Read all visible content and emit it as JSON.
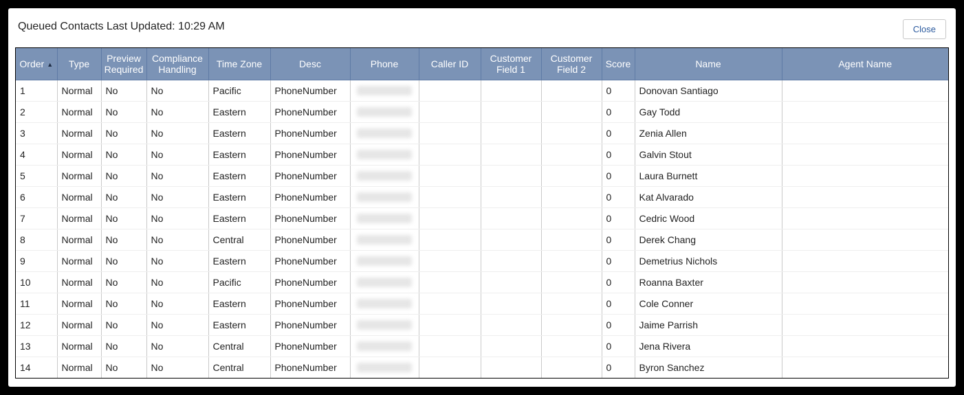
{
  "header": {
    "status_text": "Queued Contacts Last Updated: 10:29 AM",
    "close_label": "Close"
  },
  "table": {
    "sort_column": "Order",
    "sort_dir": "asc",
    "columns": [
      {
        "key": "order",
        "label": "Order"
      },
      {
        "key": "type",
        "label": "Type"
      },
      {
        "key": "preview",
        "label": "Preview Required"
      },
      {
        "key": "compliance",
        "label": "Compliance Handling"
      },
      {
        "key": "tz",
        "label": "Time Zone"
      },
      {
        "key": "desc",
        "label": "Desc"
      },
      {
        "key": "phone",
        "label": "Phone"
      },
      {
        "key": "callerid",
        "label": "Caller ID"
      },
      {
        "key": "cf1",
        "label": "Customer Field 1"
      },
      {
        "key": "cf2",
        "label": "Customer Field 2"
      },
      {
        "key": "score",
        "label": "Score"
      },
      {
        "key": "name",
        "label": "Name"
      },
      {
        "key": "agent",
        "label": "Agent Name"
      }
    ],
    "rows": [
      {
        "order": "1",
        "type": "Normal",
        "preview": "No",
        "compliance": "No",
        "tz": "Pacific",
        "desc": "PhoneNumber",
        "phone": "",
        "callerid": "",
        "cf1": "",
        "cf2": "",
        "score": "0",
        "name": "Donovan Santiago",
        "agent": ""
      },
      {
        "order": "2",
        "type": "Normal",
        "preview": "No",
        "compliance": "No",
        "tz": "Eastern",
        "desc": "PhoneNumber",
        "phone": "",
        "callerid": "",
        "cf1": "",
        "cf2": "",
        "score": "0",
        "name": "Gay Todd",
        "agent": ""
      },
      {
        "order": "3",
        "type": "Normal",
        "preview": "No",
        "compliance": "No",
        "tz": "Eastern",
        "desc": "PhoneNumber",
        "phone": "",
        "callerid": "",
        "cf1": "",
        "cf2": "",
        "score": "0",
        "name": "Zenia Allen",
        "agent": ""
      },
      {
        "order": "4",
        "type": "Normal",
        "preview": "No",
        "compliance": "No",
        "tz": "Eastern",
        "desc": "PhoneNumber",
        "phone": "",
        "callerid": "",
        "cf1": "",
        "cf2": "",
        "score": "0",
        "name": "Galvin Stout",
        "agent": ""
      },
      {
        "order": "5",
        "type": "Normal",
        "preview": "No",
        "compliance": "No",
        "tz": "Eastern",
        "desc": "PhoneNumber",
        "phone": "",
        "callerid": "",
        "cf1": "",
        "cf2": "",
        "score": "0",
        "name": "Laura Burnett",
        "agent": ""
      },
      {
        "order": "6",
        "type": "Normal",
        "preview": "No",
        "compliance": "No",
        "tz": "Eastern",
        "desc": "PhoneNumber",
        "phone": "",
        "callerid": "",
        "cf1": "",
        "cf2": "",
        "score": "0",
        "name": "Kat Alvarado",
        "agent": ""
      },
      {
        "order": "7",
        "type": "Normal",
        "preview": "No",
        "compliance": "No",
        "tz": "Eastern",
        "desc": "PhoneNumber",
        "phone": "",
        "callerid": "",
        "cf1": "",
        "cf2": "",
        "score": "0",
        "name": "Cedric Wood",
        "agent": ""
      },
      {
        "order": "8",
        "type": "Normal",
        "preview": "No",
        "compliance": "No",
        "tz": "Central",
        "desc": "PhoneNumber",
        "phone": "",
        "callerid": "",
        "cf1": "",
        "cf2": "",
        "score": "0",
        "name": "Derek Chang",
        "agent": ""
      },
      {
        "order": "9",
        "type": "Normal",
        "preview": "No",
        "compliance": "No",
        "tz": "Eastern",
        "desc": "PhoneNumber",
        "phone": "",
        "callerid": "",
        "cf1": "",
        "cf2": "",
        "score": "0",
        "name": "Demetrius Nichols",
        "agent": ""
      },
      {
        "order": "10",
        "type": "Normal",
        "preview": "No",
        "compliance": "No",
        "tz": "Pacific",
        "desc": "PhoneNumber",
        "phone": "",
        "callerid": "",
        "cf1": "",
        "cf2": "",
        "score": "0",
        "name": "Roanna Baxter",
        "agent": ""
      },
      {
        "order": "11",
        "type": "Normal",
        "preview": "No",
        "compliance": "No",
        "tz": "Eastern",
        "desc": "PhoneNumber",
        "phone": "",
        "callerid": "",
        "cf1": "",
        "cf2": "",
        "score": "0",
        "name": "Cole Conner",
        "agent": ""
      },
      {
        "order": "12",
        "type": "Normal",
        "preview": "No",
        "compliance": "No",
        "tz": "Eastern",
        "desc": "PhoneNumber",
        "phone": "",
        "callerid": "",
        "cf1": "",
        "cf2": "",
        "score": "0",
        "name": "Jaime Parrish",
        "agent": ""
      },
      {
        "order": "13",
        "type": "Normal",
        "preview": "No",
        "compliance": "No",
        "tz": "Central",
        "desc": "PhoneNumber",
        "phone": "",
        "callerid": "",
        "cf1": "",
        "cf2": "",
        "score": "0",
        "name": "Jena Rivera",
        "agent": ""
      },
      {
        "order": "14",
        "type": "Normal",
        "preview": "No",
        "compliance": "No",
        "tz": "Central",
        "desc": "PhoneNumber",
        "phone": "",
        "callerid": "",
        "cf1": "",
        "cf2": "",
        "score": "0",
        "name": "Byron Sanchez",
        "agent": ""
      }
    ]
  }
}
